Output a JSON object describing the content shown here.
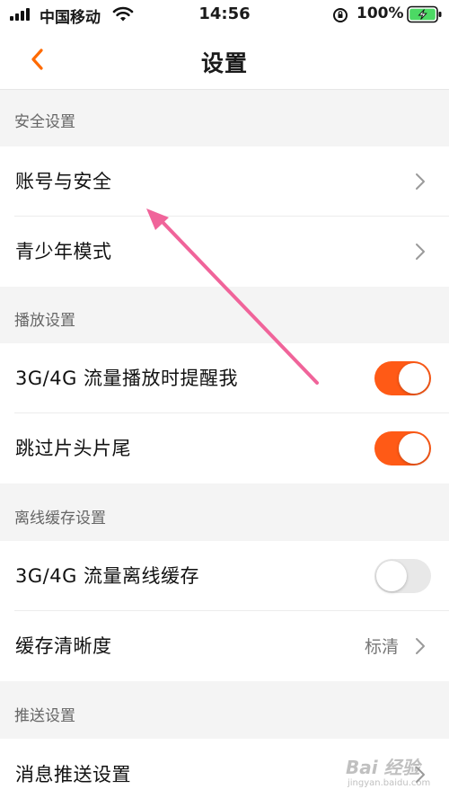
{
  "status_bar": {
    "carrier": "中国移动",
    "time": "14:56",
    "battery_percent": "100%",
    "signal_icon": "cellular-signal-icon",
    "wifi_icon": "wifi-icon",
    "orientation_lock_icon": "orientation-lock-icon",
    "battery_icon": "battery-charging-icon",
    "battery_color": "#4cd964"
  },
  "nav": {
    "title": "设置",
    "back_icon": "chevron-left-icon",
    "accent_color": "#ff6a00"
  },
  "sections": [
    {
      "header": "安全设置",
      "rows": [
        {
          "label": "账号与安全"
        },
        {
          "label": "青少年模式"
        }
      ]
    },
    {
      "header": "播放设置",
      "rows": [
        {
          "label": "3G/4G 流量播放时提醒我",
          "toggle": true
        },
        {
          "label": "跳过片头片尾",
          "toggle": true
        }
      ]
    },
    {
      "header": "离线缓存设置",
      "rows": [
        {
          "label": "3G/4G 流量离线缓存",
          "toggle": false
        },
        {
          "label": "缓存清晰度",
          "value": "标清"
        }
      ]
    },
    {
      "header": "推送设置",
      "rows": [
        {
          "label": "消息推送设置"
        }
      ]
    }
  ],
  "colors": {
    "toggle_on": "#ff5a16",
    "toggle_off": "#e8e8e8",
    "annotation_arrow": "#f0649a"
  },
  "watermark": {
    "text": "Bai 经验",
    "sub": "jingyan.baidu.com"
  }
}
